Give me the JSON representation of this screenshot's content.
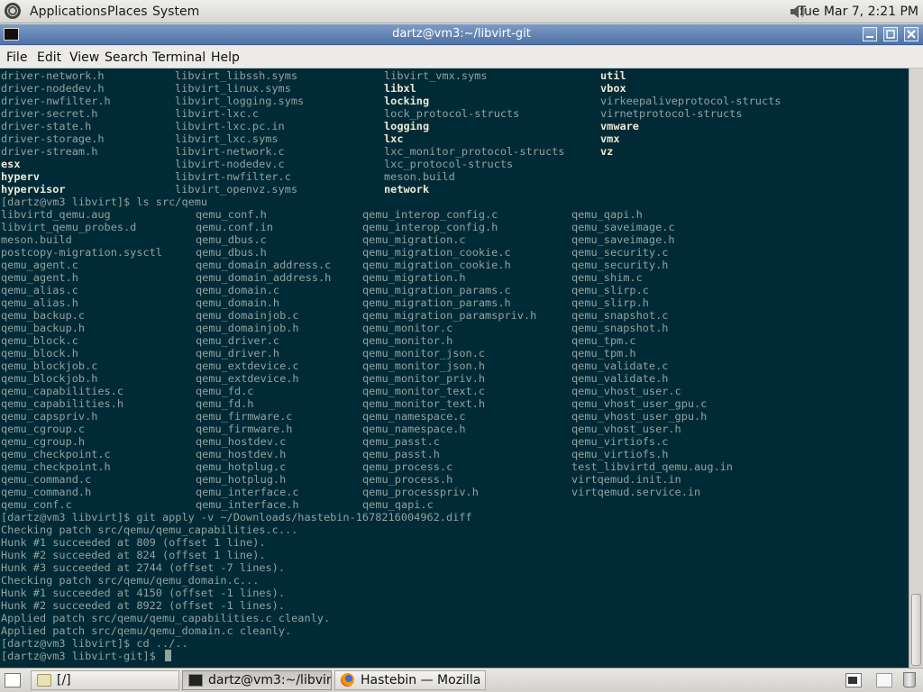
{
  "top_panel": {
    "menus": [
      "Applications",
      "Places",
      "System"
    ],
    "clock": "Tue Mar  7,  2:21 PM"
  },
  "window": {
    "title": "dartz@vm3:~/libvirt-git"
  },
  "menubar": [
    "File",
    "Edit",
    "View",
    "Search",
    "Terminal",
    "Help"
  ],
  "terminal": {
    "cursor_line_prompt": "[dartz@vm3 libvirt-git]$ ",
    "lines": [
      {
        "cells": [
          [
            "driver-network.h",
            0
          ],
          [
            "libvirt_libssh.syms",
            0
          ],
          [
            "libvirt_vmx.syms",
            0
          ],
          [
            "util",
            1
          ]
        ]
      },
      {
        "cells": [
          [
            "driver-nodedev.h",
            0
          ],
          [
            "libvirt_linux.syms",
            0
          ],
          [
            "libxl",
            1
          ],
          [
            "vbox",
            1
          ]
        ]
      },
      {
        "cells": [
          [
            "driver-nwfilter.h",
            0
          ],
          [
            "libvirt_logging.syms",
            0
          ],
          [
            "locking",
            1
          ],
          [
            "virkeepaliveprotocol-structs",
            0
          ]
        ]
      },
      {
        "cells": [
          [
            "driver-secret.h",
            0
          ],
          [
            "libvirt-lxc.c",
            0
          ],
          [
            "lock_protocol-structs",
            0
          ],
          [
            "virnetprotocol-structs",
            0
          ]
        ]
      },
      {
        "cells": [
          [
            "driver-state.h",
            0
          ],
          [
            "libvirt-lxc.pc.in",
            0
          ],
          [
            "logging",
            1
          ],
          [
            "vmware",
            1
          ]
        ]
      },
      {
        "cells": [
          [
            "driver-storage.h",
            0
          ],
          [
            "libvirt_lxc.syms",
            0
          ],
          [
            "lxc",
            1
          ],
          [
            "vmx",
            1
          ]
        ]
      },
      {
        "cells": [
          [
            "driver-stream.h",
            0
          ],
          [
            "libvirt-network.c",
            0
          ],
          [
            "lxc_monitor_protocol-structs",
            0
          ],
          [
            "vz",
            1
          ]
        ]
      },
      {
        "cells": [
          [
            "esx",
            1
          ],
          [
            "libvirt-nodedev.c",
            0
          ],
          [
            "lxc_protocol-structs",
            0
          ]
        ]
      },
      {
        "cells": [
          [
            "hyperv",
            1
          ],
          [
            "libvirt-nwfilter.c",
            0
          ],
          [
            "meson.build",
            0
          ]
        ]
      },
      {
        "cells": [
          [
            "hypervisor",
            1
          ],
          [
            "libvirt_openvz.syms",
            0
          ],
          [
            "network",
            1
          ]
        ]
      },
      {
        "text": "[dartz@vm3 libvirt]$ ls src/qemu"
      },
      {
        "cells": [
          [
            "libvirtd_qemu.aug",
            0
          ],
          [
            "qemu_conf.h",
            0
          ],
          [
            "qemu_interop_config.c",
            0
          ],
          [
            "qemu_qapi.h",
            0
          ]
        ]
      },
      {
        "cells": [
          [
            "libvirt_qemu_probes.d",
            0
          ],
          [
            "qemu.conf.in",
            0
          ],
          [
            "qemu_interop_config.h",
            0
          ],
          [
            "qemu_saveimage.c",
            0
          ]
        ]
      },
      {
        "cells": [
          [
            "meson.build",
            0
          ],
          [
            "qemu_dbus.c",
            0
          ],
          [
            "qemu_migration.c",
            0
          ],
          [
            "qemu_saveimage.h",
            0
          ]
        ]
      },
      {
        "cells": [
          [
            "postcopy-migration.sysctl",
            0
          ],
          [
            "qemu_dbus.h",
            0
          ],
          [
            "qemu_migration_cookie.c",
            0
          ],
          [
            "qemu_security.c",
            0
          ]
        ]
      },
      {
        "cells": [
          [
            "qemu_agent.c",
            0
          ],
          [
            "qemu_domain_address.c",
            0
          ],
          [
            "qemu_migration_cookie.h",
            0
          ],
          [
            "qemu_security.h",
            0
          ]
        ]
      },
      {
        "cells": [
          [
            "qemu_agent.h",
            0
          ],
          [
            "qemu_domain_address.h",
            0
          ],
          [
            "qemu_migration.h",
            0
          ],
          [
            "qemu_shim.c",
            0
          ]
        ]
      },
      {
        "cells": [
          [
            "qemu_alias.c",
            0
          ],
          [
            "qemu_domain.c",
            0
          ],
          [
            "qemu_migration_params.c",
            0
          ],
          [
            "qemu_slirp.c",
            0
          ]
        ]
      },
      {
        "cells": [
          [
            "qemu_alias.h",
            0
          ],
          [
            "qemu_domain.h",
            0
          ],
          [
            "qemu_migration_params.h",
            0
          ],
          [
            "qemu_slirp.h",
            0
          ]
        ]
      },
      {
        "cells": [
          [
            "qemu_backup.c",
            0
          ],
          [
            "qemu_domainjob.c",
            0
          ],
          [
            "qemu_migration_paramspriv.h",
            0
          ],
          [
            "qemu_snapshot.c",
            0
          ]
        ]
      },
      {
        "cells": [
          [
            "qemu_backup.h",
            0
          ],
          [
            "qemu_domainjob.h",
            0
          ],
          [
            "qemu_monitor.c",
            0
          ],
          [
            "qemu_snapshot.h",
            0
          ]
        ]
      },
      {
        "cells": [
          [
            "qemu_block.c",
            0
          ],
          [
            "qemu_driver.c",
            0
          ],
          [
            "qemu_monitor.h",
            0
          ],
          [
            "qemu_tpm.c",
            0
          ]
        ]
      },
      {
        "cells": [
          [
            "qemu_block.h",
            0
          ],
          [
            "qemu_driver.h",
            0
          ],
          [
            "qemu_monitor_json.c",
            0
          ],
          [
            "qemu_tpm.h",
            0
          ]
        ]
      },
      {
        "cells": [
          [
            "qemu_blockjob.c",
            0
          ],
          [
            "qemu_extdevice.c",
            0
          ],
          [
            "qemu_monitor_json.h",
            0
          ],
          [
            "qemu_validate.c",
            0
          ]
        ]
      },
      {
        "cells": [
          [
            "qemu_blockjob.h",
            0
          ],
          [
            "qemu_extdevice.h",
            0
          ],
          [
            "qemu_monitor_priv.h",
            0
          ],
          [
            "qemu_validate.h",
            0
          ]
        ]
      },
      {
        "cells": [
          [
            "qemu_capabilities.c",
            0
          ],
          [
            "qemu_fd.c",
            0
          ],
          [
            "qemu_monitor_text.c",
            0
          ],
          [
            "qemu_vhost_user.c",
            0
          ]
        ]
      },
      {
        "cells": [
          [
            "qemu_capabilities.h",
            0
          ],
          [
            "qemu_fd.h",
            0
          ],
          [
            "qemu_monitor_text.h",
            0
          ],
          [
            "qemu_vhost_user_gpu.c",
            0
          ]
        ]
      },
      {
        "cells": [
          [
            "qemu_capspriv.h",
            0
          ],
          [
            "qemu_firmware.c",
            0
          ],
          [
            "qemu_namespace.c",
            0
          ],
          [
            "qemu_vhost_user_gpu.h",
            0
          ]
        ]
      },
      {
        "cells": [
          [
            "qemu_cgroup.c",
            0
          ],
          [
            "qemu_firmware.h",
            0
          ],
          [
            "qemu_namespace.h",
            0
          ],
          [
            "qemu_vhost_user.h",
            0
          ]
        ]
      },
      {
        "cells": [
          [
            "qemu_cgroup.h",
            0
          ],
          [
            "qemu_hostdev.c",
            0
          ],
          [
            "qemu_passt.c",
            0
          ],
          [
            "qemu_virtiofs.c",
            0
          ]
        ]
      },
      {
        "cells": [
          [
            "qemu_checkpoint.c",
            0
          ],
          [
            "qemu_hostdev.h",
            0
          ],
          [
            "qemu_passt.h",
            0
          ],
          [
            "qemu_virtiofs.h",
            0
          ]
        ]
      },
      {
        "cells": [
          [
            "qemu_checkpoint.h",
            0
          ],
          [
            "qemu_hotplug.c",
            0
          ],
          [
            "qemu_process.c",
            0
          ],
          [
            "test_libvirtd_qemu.aug.in",
            0
          ]
        ]
      },
      {
        "cells": [
          [
            "qemu_command.c",
            0
          ],
          [
            "qemu_hotplug.h",
            0
          ],
          [
            "qemu_process.h",
            0
          ],
          [
            "virtqemud.init.in",
            0
          ]
        ]
      },
      {
        "cells": [
          [
            "qemu_command.h",
            0
          ],
          [
            "qemu_interface.c",
            0
          ],
          [
            "qemu_processpriv.h",
            0
          ],
          [
            "virtqemud.service.in",
            0
          ]
        ]
      },
      {
        "cells": [
          [
            "qemu_conf.c",
            0
          ],
          [
            "qemu_interface.h",
            0
          ],
          [
            "qemu_qapi.c",
            0
          ]
        ]
      },
      {
        "text": "[dartz@vm3 libvirt]$ git apply -v ~/Downloads/hastebin-1678216004962.diff"
      },
      {
        "text": "Checking patch src/qemu/qemu_capabilities.c..."
      },
      {
        "text": "Hunk #1 succeeded at 809 (offset 1 line)."
      },
      {
        "text": "Hunk #2 succeeded at 824 (offset 1 line)."
      },
      {
        "text": "Hunk #3 succeeded at 2744 (offset -7 lines)."
      },
      {
        "text": "Checking patch src/qemu/qemu_domain.c..."
      },
      {
        "text": "Hunk #1 succeeded at 4150 (offset -1 lines)."
      },
      {
        "text": "Hunk #2 succeeded at 8922 (offset -1 lines)."
      },
      {
        "text": "Applied patch src/qemu/qemu_capabilities.c cleanly."
      },
      {
        "text": "Applied patch src/qemu/qemu_domain.c cleanly."
      },
      {
        "text": "[dartz@vm3 libvirt]$ cd ../.."
      }
    ]
  },
  "taskbar": {
    "tasks": [
      "[/]",
      "dartz@vm3:~/libvirt...",
      "Hastebin — Mozilla ..."
    ]
  }
}
